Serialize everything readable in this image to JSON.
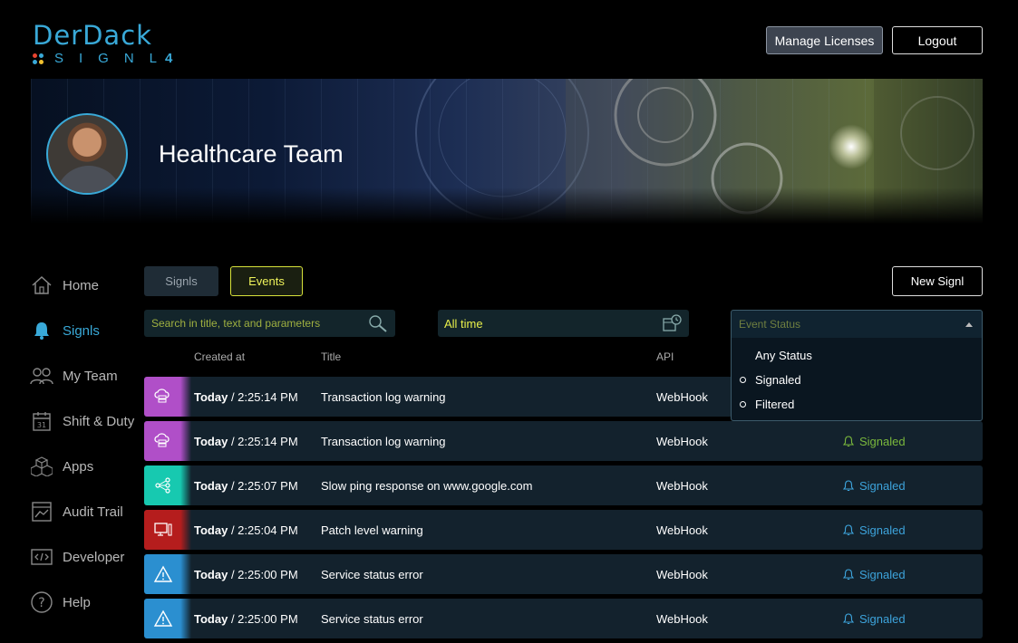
{
  "brand": {
    "logo_top": "DerDack",
    "logo_sub": "SIGNL",
    "logo_num": "4"
  },
  "header": {
    "manage_label": "Manage Licenses",
    "logout_label": "Logout"
  },
  "team": {
    "name": "Healthcare Team"
  },
  "sidebar": {
    "items": [
      {
        "label": "Home",
        "icon": "home-icon"
      },
      {
        "label": "Signls",
        "icon": "bell-icon",
        "active": true
      },
      {
        "label": "My Team",
        "icon": "team-icon"
      },
      {
        "label": "Shift & Duty",
        "icon": "calendar-icon"
      },
      {
        "label": "Apps",
        "icon": "apps-icon"
      },
      {
        "label": "Audit Trail",
        "icon": "audit-icon"
      },
      {
        "label": "Developer",
        "icon": "code-icon"
      },
      {
        "label": "Help",
        "icon": "help-icon"
      }
    ]
  },
  "tabs": {
    "signls": "Signls",
    "events": "Events",
    "new_signl": "New Signl"
  },
  "filters": {
    "search_placeholder": "Search in title, text and parameters",
    "time_value": "All time",
    "status_placeholder": "Event Status",
    "status_options": [
      "Any Status",
      "Signaled",
      "Filtered"
    ]
  },
  "columns": {
    "created": "Created at",
    "title": "Title",
    "api": "API"
  },
  "rows": [
    {
      "day": "Today",
      "time": " / 2:25:14 PM",
      "title": "Transaction log warning",
      "api": "WebHook",
      "status": "",
      "color": "#b04fc8"
    },
    {
      "day": "Today",
      "time": " / 2:25:14 PM",
      "title": "Transaction log warning",
      "api": "WebHook",
      "status": "Signaled",
      "color": "#b04fc8"
    },
    {
      "day": "Today",
      "time": " / 2:25:07 PM",
      "title": "Slow ping response on www.google.com",
      "api": "WebHook",
      "status": "Signaled",
      "color": "#17c9b0"
    },
    {
      "day": "Today",
      "time": " / 2:25:04 PM",
      "title": "Patch level warning",
      "api": "WebHook",
      "status": "Signaled",
      "color": "#b51d1d"
    },
    {
      "day": "Today",
      "time": " / 2:25:00 PM",
      "title": "Service status error",
      "api": "WebHook",
      "status": "Signaled",
      "color": "#2b8fd0"
    },
    {
      "day": "Today",
      "time": " / 2:25:00 PM",
      "title": "Service status error",
      "api": "WebHook",
      "status": "Signaled",
      "color": "#2b8fd0"
    }
  ]
}
